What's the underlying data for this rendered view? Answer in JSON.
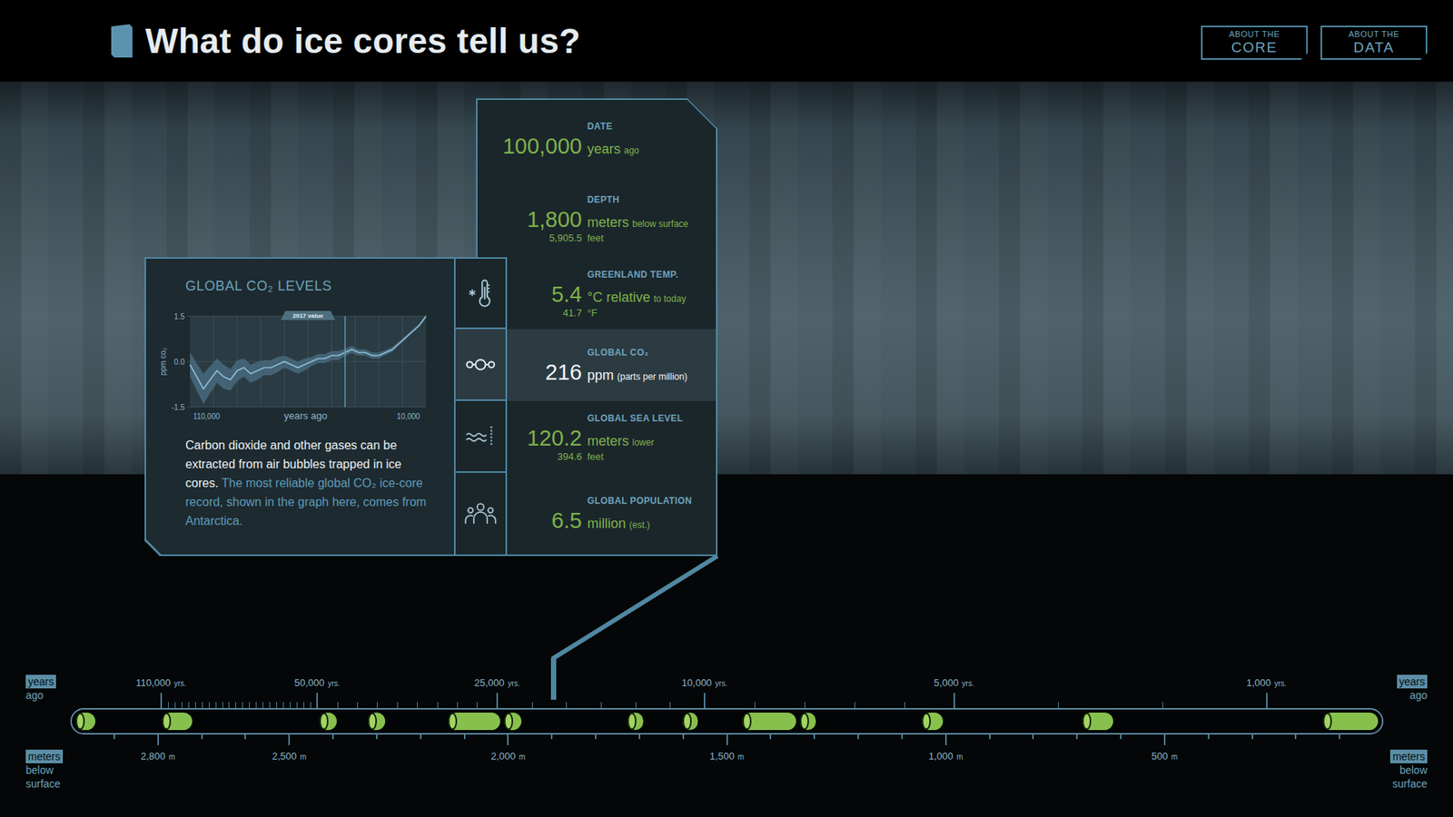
{
  "header": {
    "title": "What do ice cores tell us?",
    "buttons": [
      {
        "top": "ABOUT THE",
        "label": "CORE"
      },
      {
        "top": "ABOUT THE",
        "label": "DATA"
      }
    ]
  },
  "readings": [
    {
      "label": "DATE",
      "value": "100,000",
      "unit": "years",
      "note": "ago",
      "has_icon": false,
      "selected": false
    },
    {
      "label": "DEPTH",
      "value": "1,800",
      "unit": "meters",
      "note": "below surface",
      "sub": {
        "value": "5,905.5",
        "unit": "feet"
      },
      "has_icon": false,
      "selected": false
    },
    {
      "label": "GREENLAND TEMP.",
      "value": "5.4",
      "unit": "°C relative",
      "note": "to today",
      "sub": {
        "value": "41.7",
        "unit": "°F"
      },
      "has_icon": true,
      "selected": false
    },
    {
      "label": "GLOBAL CO₂",
      "value": "216",
      "unit": "ppm",
      "note": "(parts per million)",
      "has_icon": true,
      "selected": true
    },
    {
      "label": "GLOBAL SEA LEVEL",
      "value": "120.2",
      "unit": "meters",
      "note": "lower",
      "sub": {
        "value": "394.6",
        "unit": "feet"
      },
      "has_icon": true,
      "selected": false
    },
    {
      "label": "GLOBAL POPULATION",
      "value": "6.5",
      "unit": "million",
      "note": "(est.)",
      "has_icon": true,
      "selected": false
    }
  ],
  "detail": {
    "title": "GLOBAL CO₂ LEVELS",
    "chart": {
      "y_label": "ppm co₂",
      "y_min": -1.5,
      "y_max": 1.5,
      "y_ticks": [
        {
          "text": "1.5",
          "value": 1.5
        },
        {
          "text": "0.0",
          "value": 0
        },
        {
          "text": "-1.5",
          "value": -1.5
        }
      ],
      "x_labels": [
        {
          "text": "110,000",
          "at": 0.07,
          "kind": "tick"
        },
        {
          "text": "years ago",
          "at": 0.49,
          "kind": "title"
        },
        {
          "text": "10,000",
          "at": 0.925,
          "kind": "tick"
        }
      ],
      "badge": {
        "text": "2017 value",
        "at": 0.5
      },
      "values": [
        -0.1,
        -0.5,
        -0.9,
        -0.6,
        -0.3,
        -0.5,
        -0.6,
        -0.3,
        -0.2,
        -0.4,
        -0.3,
        -0.2,
        -0.2,
        -0.1,
        0.0,
        -0.1,
        -0.2,
        -0.1,
        0.0,
        0.1,
        0.1,
        0.2,
        0.2,
        0.3,
        0.4,
        0.3,
        0.3,
        0.2,
        0.2,
        0.3,
        0.4,
        0.6,
        0.8,
        1.0,
        1.2,
        1.5
      ],
      "spread": [
        0.4,
        0.45,
        0.5,
        0.45,
        0.4,
        0.4,
        0.35,
        0.35,
        0.3,
        0.3,
        0.3,
        0.25,
        0.25,
        0.25,
        0.2,
        0.2,
        0.2,
        0.2,
        0.15,
        0.15,
        0.15,
        0.15,
        0.15,
        0.12,
        0.12,
        0.1,
        0.1,
        0.1,
        0.1,
        0.08,
        0.08,
        0.06,
        0.06,
        0.05,
        0.05,
        0.05
      ],
      "marker_index": 23
    },
    "text": "Carbon dioxide and other gases can be extracted from air bubbles trapped in ice cores.",
    "link_text": "The most reliable global CO₂ ice-core record, shown in the graph here, comes from Antarctica."
  },
  "timeline": {
    "top_axis": {
      "labels": [
        {
          "text": "110,000",
          "unit": "yrs.",
          "at": 0.069
        },
        {
          "text": "50,000",
          "unit": "yrs.",
          "at": 0.188
        },
        {
          "text": "25,000",
          "unit": "yrs.",
          "at": 0.325
        },
        {
          "text": "10,000",
          "unit": "yrs.",
          "at": 0.483
        },
        {
          "text": "5,000",
          "unit": "yrs.",
          "at": 0.673
        },
        {
          "text": "1,000",
          "unit": "yrs.",
          "at": 0.911
        }
      ],
      "minor_ticks_between": [
        22,
        8,
        5,
        4,
        2
      ]
    },
    "depth_axis": {
      "from_m": 3000,
      "to_m": 0,
      "tick_every_m": 100,
      "labels": [
        {
          "m": 2800,
          "text": "2,800",
          "unit": "m"
        },
        {
          "m": 2500,
          "text": "2,500",
          "unit": "m"
        },
        {
          "m": 2000,
          "text": "2,000",
          "unit": "m"
        },
        {
          "m": 1500,
          "text": "1,500",
          "unit": "m"
        },
        {
          "m": 1000,
          "text": "1,000",
          "unit": "m"
        },
        {
          "m": 500,
          "text": "500",
          "unit": "m"
        }
      ]
    },
    "segments": [
      {
        "start": 0.003,
        "end": 0.018
      },
      {
        "start": 0.069,
        "end": 0.092
      },
      {
        "start": 0.189,
        "end": 0.202
      },
      {
        "start": 0.226,
        "end": 0.239
      },
      {
        "start": 0.287,
        "end": 0.327
      },
      {
        "start": 0.33,
        "end": 0.343
      },
      {
        "start": 0.424,
        "end": 0.436
      },
      {
        "start": 0.466,
        "end": 0.478
      },
      {
        "start": 0.512,
        "end": 0.553
      },
      {
        "start": 0.556,
        "end": 0.568
      },
      {
        "start": 0.649,
        "end": 0.665
      },
      {
        "start": 0.771,
        "end": 0.795
      },
      {
        "start": 0.955,
        "end": 0.997
      }
    ],
    "cursor": 0.368,
    "sides": {
      "left": {
        "top": {
          "box": "years",
          "rest": [
            "ago"
          ]
        },
        "bottom": {
          "box": "meters",
          "rest": [
            "below",
            "surface"
          ]
        }
      },
      "right": {
        "top": {
          "box": "years",
          "rest": [
            "ago"
          ]
        },
        "bottom": {
          "box": "meters",
          "rest": [
            "below",
            "surface"
          ]
        }
      }
    }
  }
}
